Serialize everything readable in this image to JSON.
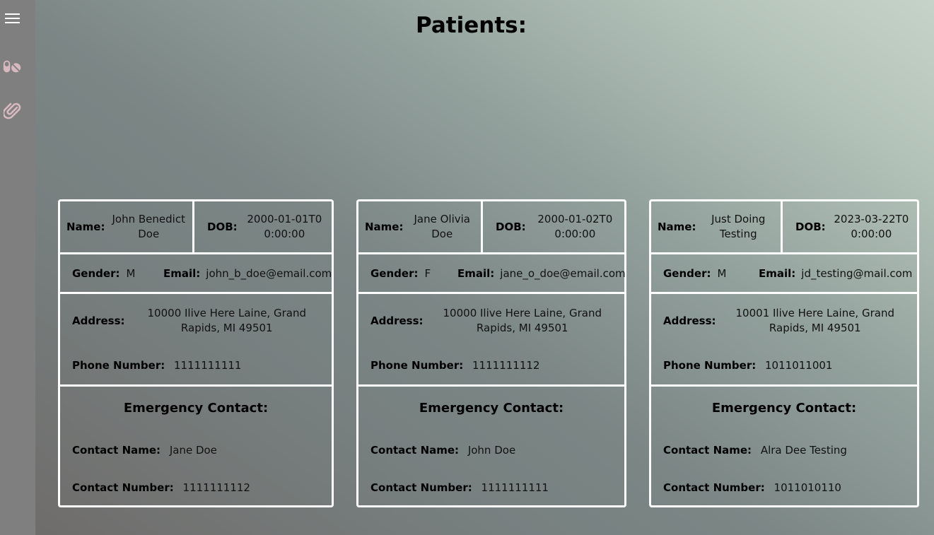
{
  "sidebar": {
    "icons": [
      "menu-icon",
      "pills-icon",
      "paperclip-icon"
    ],
    "icon_color": "#d9b9c0"
  },
  "page": {
    "title": "Patients:"
  },
  "labels": {
    "name": "Name:",
    "dob": "DOB:",
    "gender": "Gender:",
    "email": "Email:",
    "address": "Address:",
    "phone": "Phone Number:",
    "emergency": "Emergency Contact:",
    "contact_name": "Contact Name:",
    "contact_number": "Contact Number:"
  },
  "patients": [
    {
      "name": "John Benedict Doe",
      "dob": "2000-01-01T00:00:00",
      "gender": "M",
      "email": "john_b_doe@email.com",
      "address": "10000 Ilive Here Laine, Grand Rapids, MI 49501",
      "phone": "1111111111",
      "contact_name": "Jane Doe",
      "contact_number": "1111111112"
    },
    {
      "name": "Jane Olivia Doe",
      "dob": "2000-01-02T00:00:00",
      "gender": "F",
      "email": "jane_o_doe@email.com",
      "address": "10000 Ilive Here Laine, Grand Rapids, MI 49501",
      "phone": "1111111112",
      "contact_name": "John Doe",
      "contact_number": "1111111111"
    },
    {
      "name": "Just Doing Testing",
      "dob": "2023-03-22T00:00:00",
      "gender": "M",
      "email": "jd_testing@mail.com",
      "address": "10001 Ilive Here Laine, Grand Rapids, MI 49501",
      "phone": "1011011001",
      "contact_name": "Alra Dee Testing",
      "contact_number": "1011010110"
    }
  ]
}
